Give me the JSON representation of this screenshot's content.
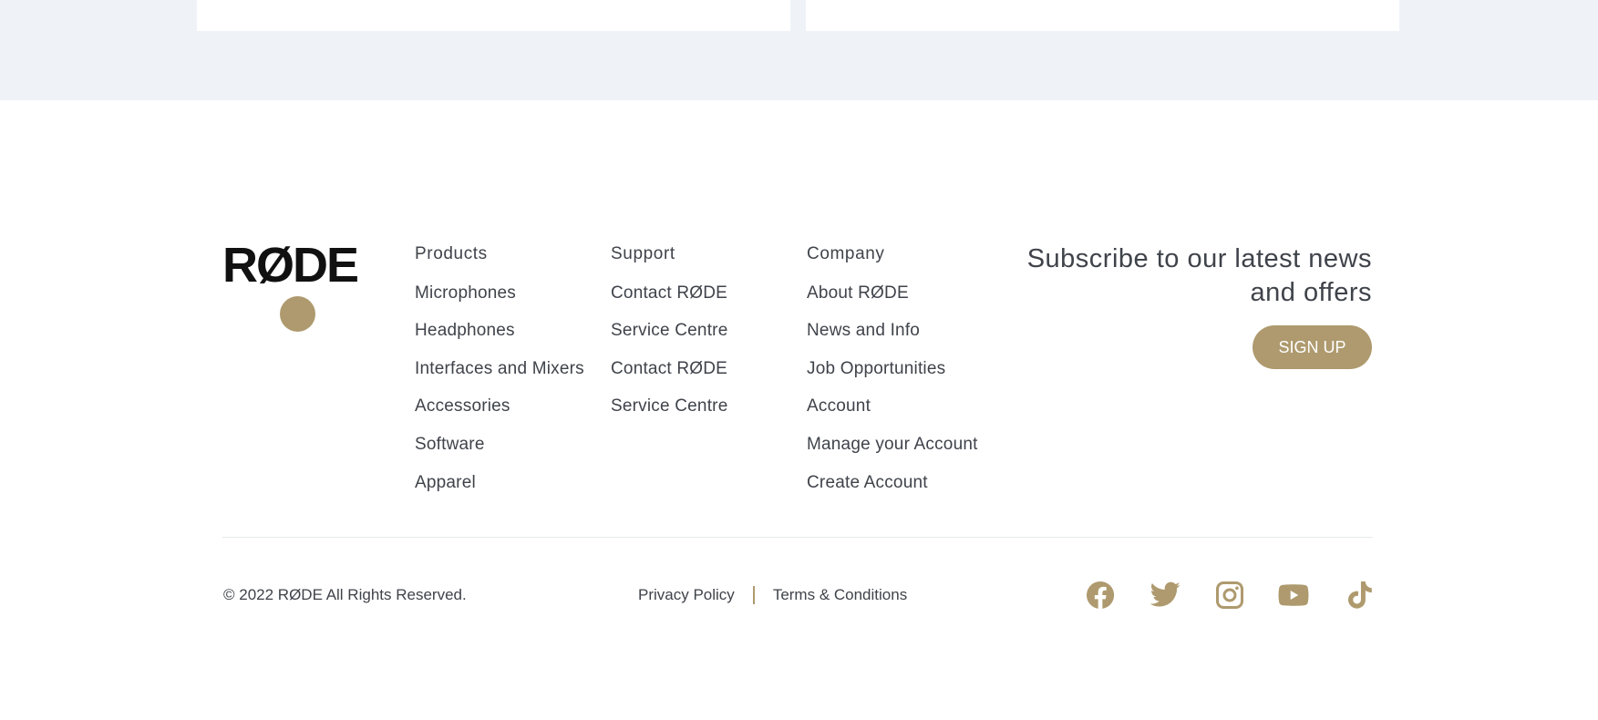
{
  "brand": {
    "logo_text": "RØDE",
    "accent_color": "#ae9a6e",
    "text_color": "#3f434a"
  },
  "footer": {
    "columns": [
      {
        "title": "Products",
        "links": [
          "Microphones",
          "Headphones",
          "Interfaces and Mixers",
          "Accessories",
          "Software",
          "Apparel"
        ]
      },
      {
        "title": "Support",
        "links": [
          "Contact RØDE",
          "Service Centre",
          "Contact RØDE",
          "Service Centre"
        ]
      },
      {
        "title": "Company",
        "links": [
          "About RØDE",
          "News and Info",
          "Job Opportunities",
          "Account",
          "Manage your Account",
          "Create Account"
        ]
      }
    ],
    "subscribe": {
      "heading": "Subscribe to our latest news and offers",
      "button_label": "SIGN UP"
    },
    "copyright": "© 2022 RØDE All Rights Reserved.",
    "legal": {
      "privacy": "Privacy Policy",
      "terms": "Terms & Conditions"
    },
    "social_icons": [
      "facebook-icon",
      "twitter-icon",
      "instagram-icon",
      "youtube-icon",
      "tiktok-icon"
    ]
  }
}
